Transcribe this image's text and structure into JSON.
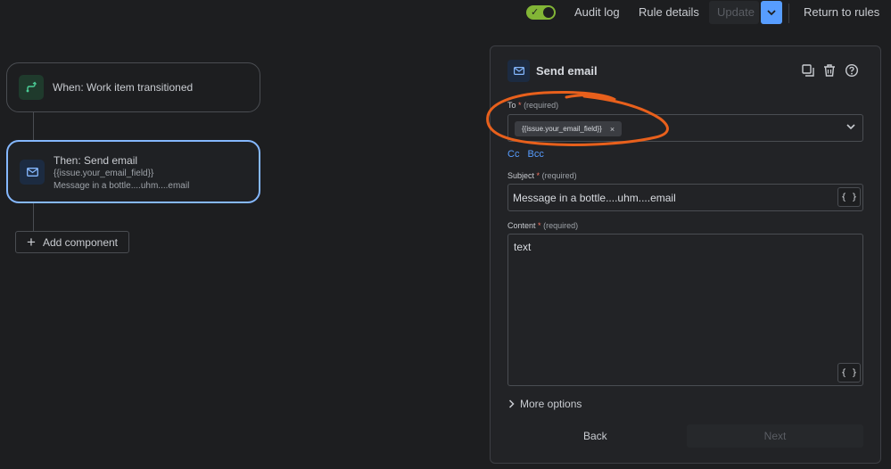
{
  "header": {
    "audit_log": "Audit log",
    "rule_details": "Rule details",
    "update": "Update",
    "return_to_rules": "Return to rules"
  },
  "canvas": {
    "trigger_title": "When: Work item transitioned",
    "action_title": "Then: Send email",
    "action_line1": "{{issue.your_email_field}}",
    "action_line2": "Message in a bottle....uhm....email",
    "add_component": "Add component"
  },
  "panel": {
    "title": "Send email",
    "to_label": "To",
    "required": "(required)",
    "to_chip": "{{issue.your_email_field}}",
    "chip_remove": "×",
    "cc": "Cc",
    "bcc": "Bcc",
    "subject_label": "Subject",
    "subject_value": "Message in a bottle....uhm....email",
    "content_label": "Content",
    "content_value": "text",
    "brace": "{ }",
    "more_options": "More options",
    "back": "Back",
    "next": "Next"
  },
  "colors": {
    "background": "#1d1e20",
    "accent_blue": "#579dff",
    "toggle_green": "#82b536",
    "annotation_orange": "#e8601c",
    "required_star": "#f87462"
  }
}
